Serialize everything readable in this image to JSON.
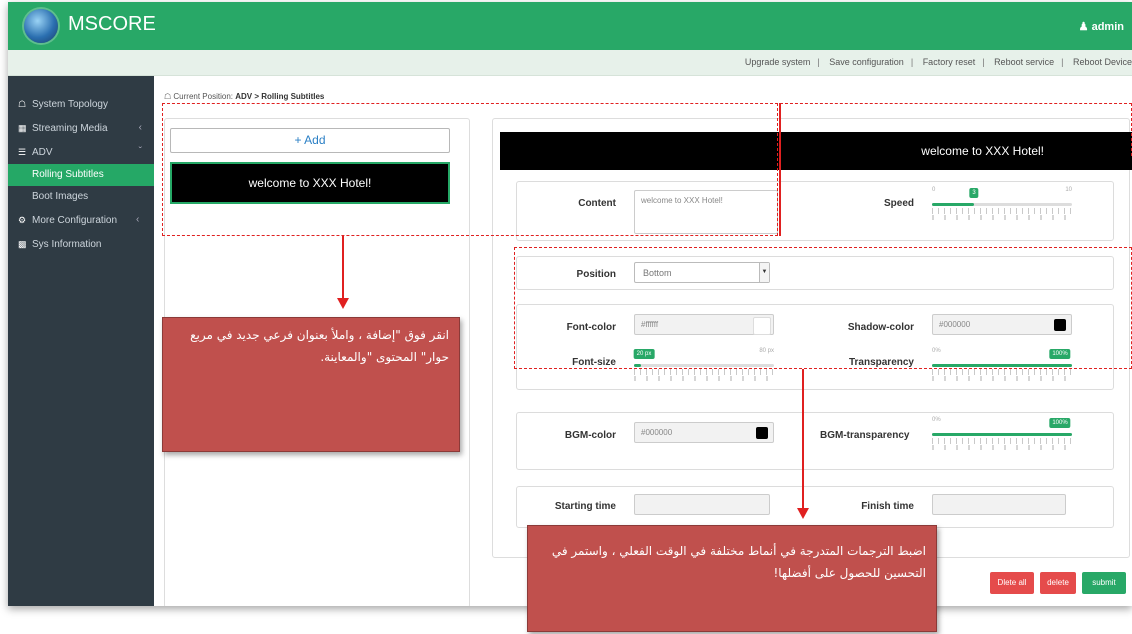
{
  "app": {
    "title": "MSCORE",
    "user": "admin"
  },
  "toolbar": {
    "links": [
      "Upgrade system",
      "Save configuration",
      "Factory reset",
      "Reboot service",
      "Reboot Device"
    ]
  },
  "sidebar": {
    "items": [
      {
        "label": "System Topology",
        "icon": "home-icon"
      },
      {
        "label": "Streaming Media",
        "icon": "film-icon"
      },
      {
        "label": "ADV",
        "icon": "list-icon"
      },
      {
        "label": "Rolling Subtitles",
        "active": true
      },
      {
        "label": "Boot Images"
      },
      {
        "label": "More Configuration",
        "icon": "gears-icon"
      },
      {
        "label": "Sys Information",
        "icon": "table-icon"
      }
    ]
  },
  "breadcrumb": {
    "prefix": "Current Position:",
    "path": "ADV > Rolling Subtitles"
  },
  "left": {
    "add_label": "+ Add",
    "item_text": "welcome to XXX Hotel!"
  },
  "preview": {
    "text": "welcome to XXX Hotel!"
  },
  "form": {
    "content_label": "Content",
    "content_value": "welcome to XXX Hotel!",
    "speed_label": "Speed",
    "speed": {
      "min": "0",
      "max": "10",
      "value": "3",
      "level": 0.3
    },
    "position_label": "Position",
    "position_value": "Bottom",
    "font_color_label": "Font-color",
    "font_color_value": "#ffffff",
    "shadow_color_label": "Shadow-color",
    "shadow_color_value": "#000000",
    "font_size_label": "Font-size",
    "font_size": {
      "value": "20 px",
      "max": "80 px",
      "level": 0.05
    },
    "transparency_label": "Transparency",
    "transparency": {
      "min": "0%",
      "value": "100%",
      "level": 1.0
    },
    "bgm_color_label": "BGM-color",
    "bgm_color_value": "#000000",
    "bgm_transparency_label": "BGM-transparency",
    "bgm_transparency": {
      "min": "0%",
      "value": "100%",
      "level": 1.0
    },
    "starting_time_label": "Starting time",
    "finish_time_label": "Finish time"
  },
  "buttons": {
    "delete_all": "Dlete all",
    "delete": "delete",
    "submit": "submit"
  },
  "callouts": {
    "add": "انقر فوق \"إضافة ، واملأ بعنوان فرعي جديد في مربع حوار\" المحتوى \"والمعاينة.",
    "adjust": "اضبط الترجمات المتدرجة في أنماط مختلفة في الوقت الفعلي ، واستمر في التحسين للحصول على أفضلها!"
  },
  "colors": {
    "accent": "#28a867",
    "sidebar": "#2f3b44",
    "danger": "#e54b4b",
    "callout": "#c0504d",
    "annotation": "#e02020"
  }
}
